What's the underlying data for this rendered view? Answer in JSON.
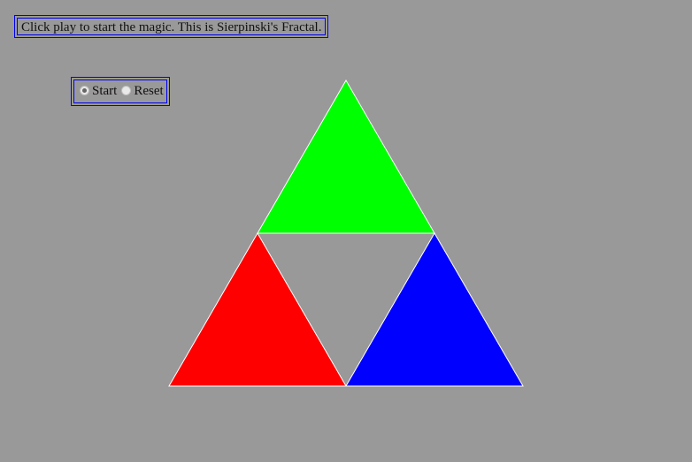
{
  "header": {
    "instruction": "Click play to start the magic. This is Sierpinski's Fractal."
  },
  "controls": {
    "options": [
      {
        "label": "Start",
        "checked": true
      },
      {
        "label": "Reset",
        "checked": false
      }
    ]
  },
  "fractal": {
    "colors": {
      "background": "#999999",
      "top": "#00ff00",
      "left": "#ff0000",
      "right": "#0000ff",
      "stroke": "#ffffff",
      "border": "#0000ee"
    }
  }
}
